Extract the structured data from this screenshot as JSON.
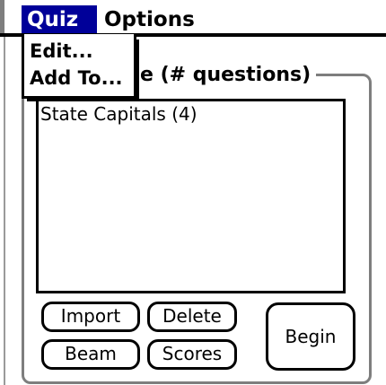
{
  "menubar": {
    "menus": [
      {
        "label": "Quiz",
        "active": true
      },
      {
        "label": "Options",
        "active": false
      }
    ],
    "highlight_color": "#000099"
  },
  "dropdown": {
    "items": [
      {
        "label": "Edit..."
      },
      {
        "label": "Add To..."
      }
    ]
  },
  "main": {
    "group_title_visible": "e (# questions)",
    "list": {
      "items": [
        {
          "label": "State Capitals (4)"
        }
      ]
    }
  },
  "buttons": {
    "import": "Import",
    "delete": "Delete",
    "beam": "Beam",
    "scores": "Scores",
    "begin": "Begin"
  }
}
